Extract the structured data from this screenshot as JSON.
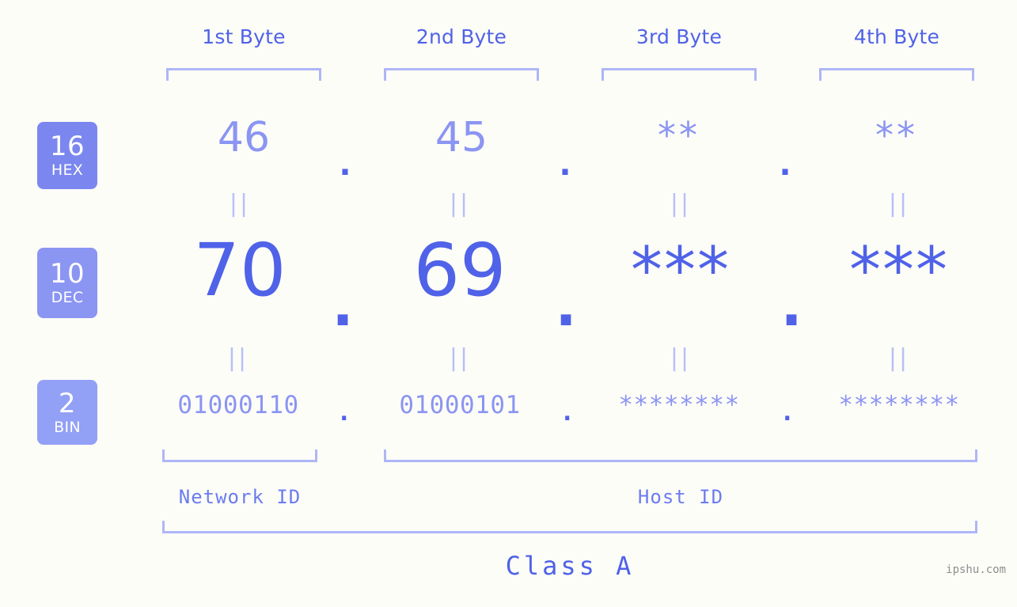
{
  "watermark": "ipshu.com",
  "byte_headers": [
    {
      "label": "1st Byte"
    },
    {
      "label": "2nd Byte"
    },
    {
      "label": "3rd Byte"
    },
    {
      "label": "4th Byte"
    }
  ],
  "bases": [
    {
      "number": "16",
      "name": "HEX",
      "color": "#7b87ef"
    },
    {
      "number": "10",
      "name": "DEC",
      "color": "#8b95f2"
    },
    {
      "number": "2",
      "name": "BIN",
      "color": "#92a0f5"
    }
  ],
  "separator": ".",
  "equals_symbol": "||",
  "rows": {
    "hex": {
      "values": [
        "46",
        "45",
        "**",
        "**"
      ]
    },
    "dec": {
      "values": [
        "70",
        "69",
        "***",
        "***"
      ]
    },
    "bin": {
      "values": [
        "01000110",
        "01000101",
        "********",
        "********"
      ]
    }
  },
  "segments": {
    "network_id": "Network ID",
    "host_id": "Host ID",
    "class": "Class A"
  },
  "colors": {
    "background": "#fdfdf8",
    "accent_strong": "#4f62e8",
    "accent_mid": "#8b95f2",
    "accent_light": "#aeb6f8"
  }
}
